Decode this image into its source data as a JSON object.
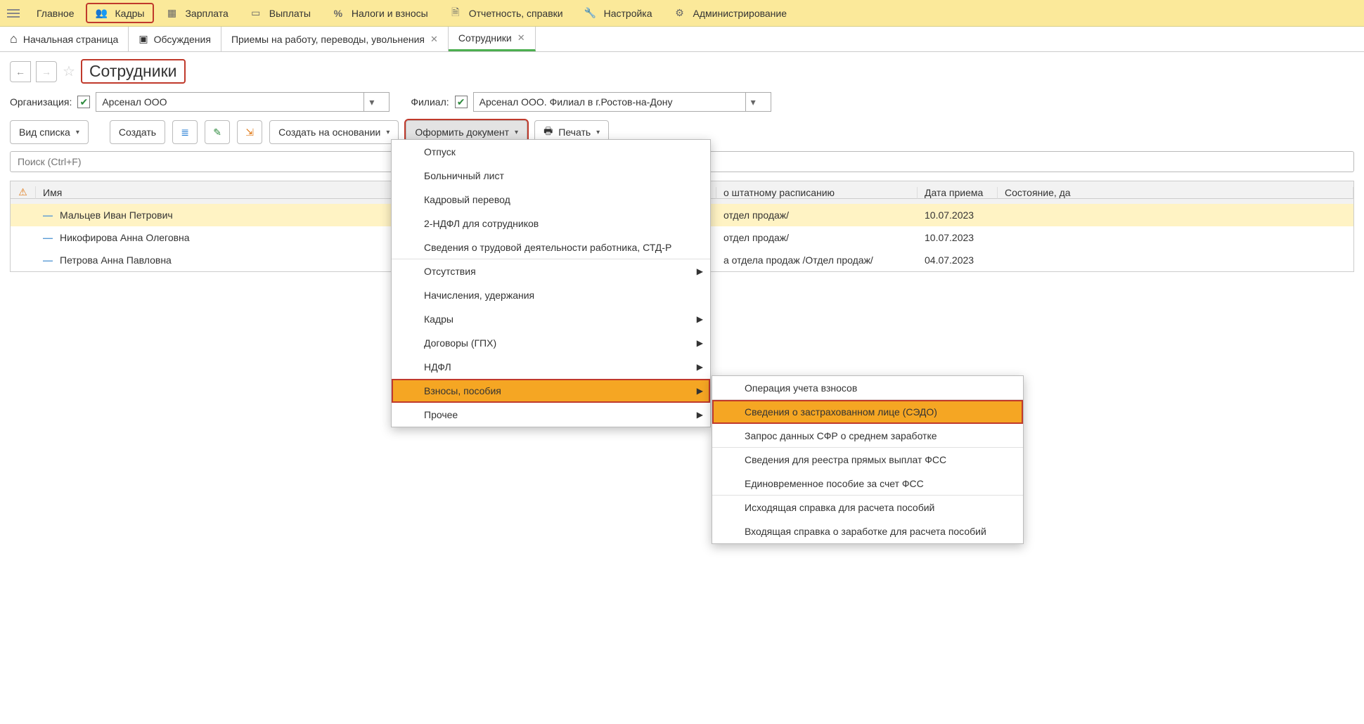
{
  "top_menu": {
    "items": [
      {
        "label": "Главное",
        "icon": "burger"
      },
      {
        "label": "Кадры",
        "icon": "users",
        "highlight": true
      },
      {
        "label": "Зарплата",
        "icon": "table"
      },
      {
        "label": "Выплаты",
        "icon": "card"
      },
      {
        "label": "Налоги и взносы",
        "icon": "percent"
      },
      {
        "label": "Отчетность, справки",
        "icon": "doc"
      },
      {
        "label": "Настройка",
        "icon": "wrench"
      },
      {
        "label": "Администрирование",
        "icon": "gear"
      }
    ]
  },
  "tabs": [
    {
      "label": "Начальная страница",
      "icon": "home",
      "closable": false
    },
    {
      "label": "Обсуждения",
      "icon": "chat",
      "closable": false
    },
    {
      "label": "Приемы на работу, переводы, увольнения",
      "closable": true
    },
    {
      "label": "Сотрудники",
      "closable": true,
      "active": true
    }
  ],
  "page_title": "Сотрудники",
  "filter": {
    "org_label": "Организация:",
    "org_checked": true,
    "org_value": "Арсенал ООО",
    "branch_label": "Филиал:",
    "branch_checked": true,
    "branch_value": "Арсенал ООО. Филиал в г.Ростов-на-Дону"
  },
  "toolbar": {
    "view_label": "Вид списка",
    "create_label": "Создать",
    "create_based_label": "Создать на основании",
    "create_doc_label": "Оформить документ",
    "print_label": "Печать"
  },
  "search": {
    "placeholder": "Поиск (Ctrl+F)"
  },
  "grid": {
    "columns": {
      "name": "Имя",
      "schedule": "о штатному расписанию",
      "hire_date": "Дата приема",
      "state": "Состояние, да"
    },
    "rows": [
      {
        "name": "Мальцев Иван Петрович",
        "schedule": "отдел продаж/",
        "hire_date": "10.07.2023",
        "selected": true
      },
      {
        "name": "Никофирова Анна Олеговна",
        "schedule": "отдел продаж/",
        "hire_date": "10.07.2023"
      },
      {
        "name": "Петрова Анна Павловна",
        "schedule": "а отдела продаж /Отдел продаж/",
        "hire_date": "04.07.2023"
      }
    ]
  },
  "create_doc_menu": [
    {
      "label": "Отпуск"
    },
    {
      "label": "Больничный лист"
    },
    {
      "label": "Кадровый перевод"
    },
    {
      "label": "2-НДФЛ для сотрудников"
    },
    {
      "label": "Сведения о трудовой деятельности работника, СТД-Р",
      "sep_after": true
    },
    {
      "label": "Отсутствия",
      "submenu": true
    },
    {
      "label": "Начисления, удержания"
    },
    {
      "label": "Кадры",
      "submenu": true
    },
    {
      "label": "Договоры (ГПХ)",
      "submenu": true
    },
    {
      "label": "НДФЛ",
      "submenu": true
    },
    {
      "label": "Взносы, пособия",
      "submenu": true,
      "active": true,
      "highlight": true
    },
    {
      "label": "Прочее",
      "submenu": true
    }
  ],
  "contrib_submenu": [
    {
      "label": "Операция учета взносов",
      "sep_after": true
    },
    {
      "label": "Сведения о застрахованном лице (СЭДО)",
      "selected": true
    },
    {
      "label": "Запрос данных СФР о среднем заработке",
      "sep_after": true
    },
    {
      "label": "Сведения для реестра прямых выплат ФСС"
    },
    {
      "label": "Единовременное пособие за счет ФСС",
      "sep_after": true
    },
    {
      "label": "Исходящая справка для расчета пособий"
    },
    {
      "label": "Входящая справка о заработке для расчета пособий"
    }
  ],
  "colors": {
    "highlight_border": "#c0392b",
    "active_fill": "#f5a623"
  }
}
